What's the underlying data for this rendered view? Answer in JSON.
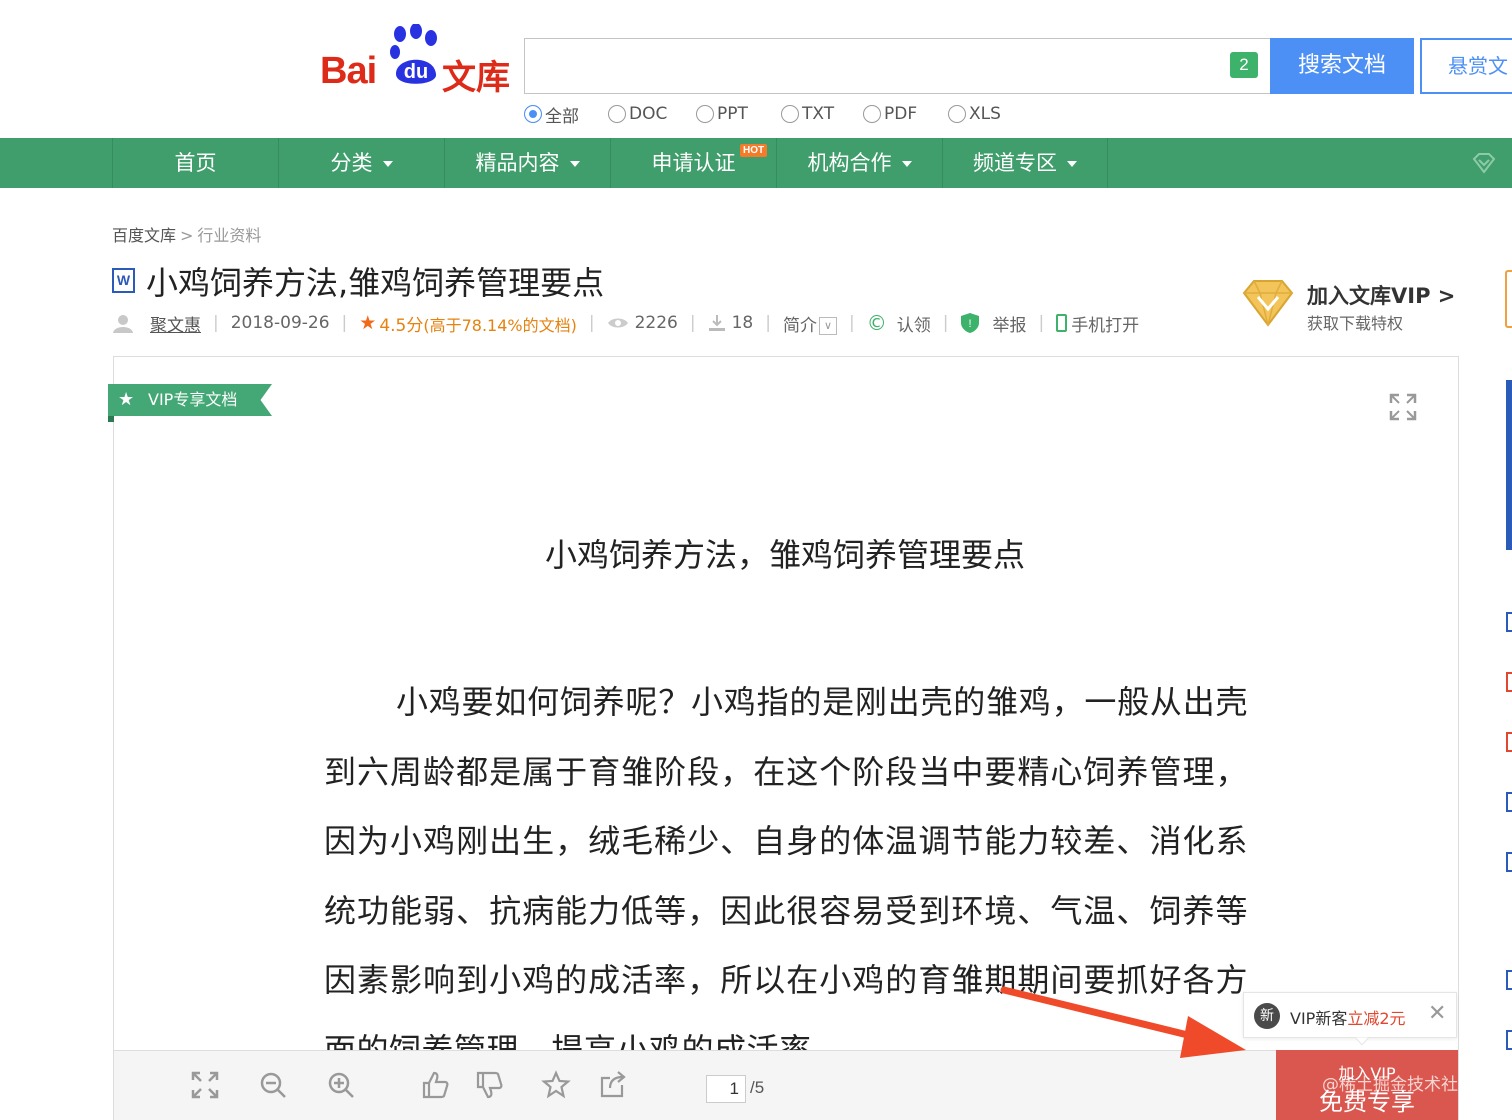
{
  "header": {
    "logo_bai": "Bai",
    "logo_du": "du",
    "logo_wenku": "文库",
    "search_placeholder": "",
    "kbd_badge": "2",
    "search_button": "搜索文档",
    "reward_button": "悬赏文",
    "filters": [
      {
        "label": "全部",
        "selected": true
      },
      {
        "label": "DOC",
        "selected": false
      },
      {
        "label": "PPT",
        "selected": false
      },
      {
        "label": "TXT",
        "selected": false
      },
      {
        "label": "PDF",
        "selected": false
      },
      {
        "label": "XLS",
        "selected": false
      }
    ]
  },
  "nav": {
    "items": [
      {
        "label": "首页"
      },
      {
        "label": "分类"
      },
      {
        "label": "精品内容"
      },
      {
        "label": "申请认证"
      },
      {
        "label": "机构合作"
      },
      {
        "label": "频道专区"
      }
    ],
    "hot_badge": "HOT"
  },
  "breadcrumb": {
    "root": "百度文库",
    "sep": ">",
    "current": "行业资料"
  },
  "doc": {
    "type_icon": "W",
    "title": "小鸡饲养方法,雏鸡饲养管理要点",
    "author": "聚文惠",
    "date": "2018-09-26",
    "rating": "4.5分",
    "rating_note_pre": "(高于",
    "rating_pct": "78.14%",
    "rating_note_post": "的文档)",
    "views": "2226",
    "downloads": "18",
    "intro_label": "简介",
    "claim_label": "认领",
    "report_label": "举报",
    "mobile_label": "手机打开"
  },
  "vip_promo": {
    "title": "加入文库VIP >",
    "subtitle": "获取下载特权"
  },
  "viewer": {
    "ribbon": "VIP专享文档",
    "page_heading": "小鸡饲养方法，雏鸡饲养管理要点",
    "page_body": "小鸡要如何饲养呢？小鸡指的是刚出壳的雏鸡，一般从出壳到六周龄都是属于育雏阶段，在这个阶段当中要精心饲养管理，因为小鸡刚出生，绒毛稀少、自身的体温调节能力较差、消化系统功能弱、抗病能力低等，因此很容易受到环境、气温、饲养等因素影响到小鸡的成活率，所以在小鸡的育雏期期间要抓好各方面的饲养管理，提高小鸡的成活率",
    "page_current": "1",
    "page_total": "/5"
  },
  "coupon": {
    "badge": "新",
    "text": "VIP新客",
    "highlight": "立减2元",
    "close": "✕"
  },
  "vip_button": {
    "small": "加入VIP",
    "big": "免费专享"
  },
  "watermark": "@稀土掘金技术社区",
  "colors": {
    "nav_green": "#3f9e6b",
    "search_blue": "#4d90f5",
    "brand_red": "#de2a18",
    "vip_red": "#d9574e"
  }
}
